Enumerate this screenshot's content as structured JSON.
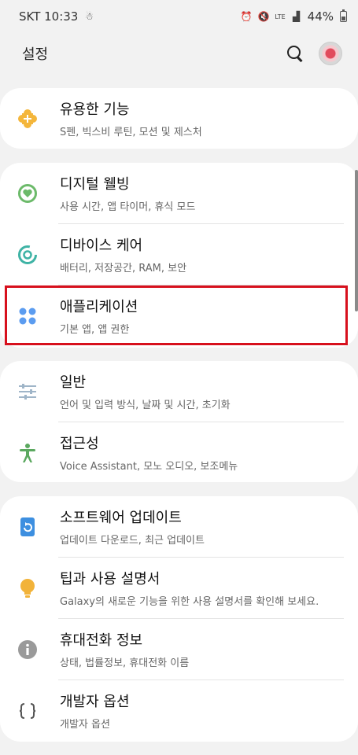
{
  "status_bar": {
    "carrier_time": "SKT 10:33",
    "network": "LTE",
    "battery": "44%"
  },
  "header": {
    "title": "설정"
  },
  "groups": [
    {
      "items": [
        {
          "title": "유용한 기능",
          "subtitle": "S펜, 빅스비 루틴, 모션 및 제스처",
          "icon": "plus-puzzle-icon",
          "icon_color": "#f4b63b"
        }
      ]
    },
    {
      "items": [
        {
          "title": "디지털 웰빙",
          "subtitle": "사용 시간, 앱 타이머, 휴식 모드",
          "icon": "heart-ring-icon",
          "icon_color": "#6cba6a"
        },
        {
          "title": "디바이스 케어",
          "subtitle": "배터리, 저장공간, RAM, 보안",
          "icon": "care-ring-icon",
          "icon_color": "#3fb3a5"
        },
        {
          "title": "애플리케이션",
          "subtitle": "기본 앱, 앱 권한",
          "icon": "apps-grid-icon",
          "icon_color": "#5b9cf0"
        }
      ]
    },
    {
      "items": [
        {
          "title": "일반",
          "subtitle": "언어 및 입력 방식, 날짜 및 시간, 초기화",
          "icon": "sliders-icon",
          "icon_color": "#9fb5c8"
        },
        {
          "title": "접근성",
          "subtitle": "Voice Assistant, 모노 오디오, 보조메뉴",
          "icon": "accessibility-person-icon",
          "icon_color": "#5ba85f"
        }
      ]
    },
    {
      "items": [
        {
          "title": "소프트웨어 업데이트",
          "subtitle": "업데이트 다운로드, 최근 업데이트",
          "icon": "update-icon",
          "icon_color": "#3d8fe0"
        },
        {
          "title": "팁과 사용 설명서",
          "subtitle": "Galaxy의 새로운 기능을 위한 사용 설명서를 확인해 보세요.",
          "icon": "lightbulb-icon",
          "icon_color": "#f2b33a"
        },
        {
          "title": "휴대전화 정보",
          "subtitle": "상태, 법률정보, 휴대전화 이름",
          "icon": "info-icon",
          "icon_color": "#9a9a9a"
        },
        {
          "title": "개발자 옵션",
          "subtitle": "개발자 옵션",
          "icon": "braces-icon",
          "icon_color": "#555555"
        }
      ]
    }
  ]
}
